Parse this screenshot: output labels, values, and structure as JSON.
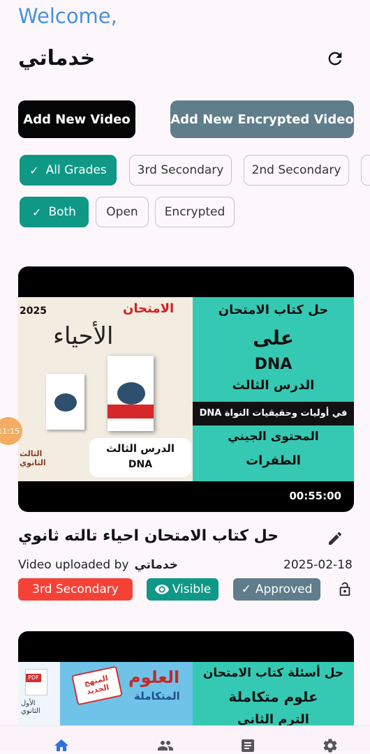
{
  "header": {
    "welcome": "Welcome,",
    "username": "خدماتي",
    "refresh_icon": "refresh-icon"
  },
  "actions": {
    "add_video": "Add New Video",
    "add_encrypted_video": "Add New Encrypted Video"
  },
  "grade_filters": [
    {
      "label": "All Grades",
      "selected": true
    },
    {
      "label": "3rd Secondary",
      "selected": false
    },
    {
      "label": "2nd Secondary",
      "selected": false
    }
  ],
  "type_filters": [
    {
      "label": "Both",
      "selected": true
    },
    {
      "label": "Open",
      "selected": false
    },
    {
      "label": "Encrypted",
      "selected": false
    }
  ],
  "timer_badge": "11:15",
  "videos": [
    {
      "thumbnail": {
        "year": "2025",
        "brand": "الامتحان",
        "subject": "الأحياء",
        "lesson_box": "الدرس الثالث",
        "lesson_topic": "DNA",
        "grade_tag": "الثالث الثانوي",
        "right_lines": [
          "حل كتاب الامتحان",
          "على",
          "DNA",
          "الدرس الثالث",
          "DNA في أوليات وحقيقيات النواة",
          "المحتوى الجيني",
          "الطفرات"
        ]
      },
      "duration": "00:55:00",
      "title": "حل كتاب الامتحان احياء تالته ثانوي",
      "uploaded_by_label": "Video uploaded by",
      "uploader": "خدماتي",
      "date": "2025-02-18",
      "grade_badge": "3rd Secondary",
      "visibility": "Visible",
      "status": "Approved"
    },
    {
      "thumbnail": {
        "left_title": "العلوم",
        "left_subtitle": "المتكاملة",
        "stamp": "المنهج الجديد",
        "grade_tag": "الأول الثانوي",
        "file_label": "PDF",
        "right_lines": [
          "حل أسئلة كتاب الامتحان",
          "علوم متكاملة",
          "الترم الثاني"
        ]
      }
    }
  ],
  "colors": {
    "accent_teal": "#0f9886",
    "welcome_blue": "#4a90d9",
    "grade_red": "#f44336",
    "status_slate": "#5f7d8b",
    "nav_blue": "#2f6fdf"
  },
  "bottom_nav": [
    "home-icon",
    "people-icon",
    "list-icon",
    "settings-icon"
  ]
}
